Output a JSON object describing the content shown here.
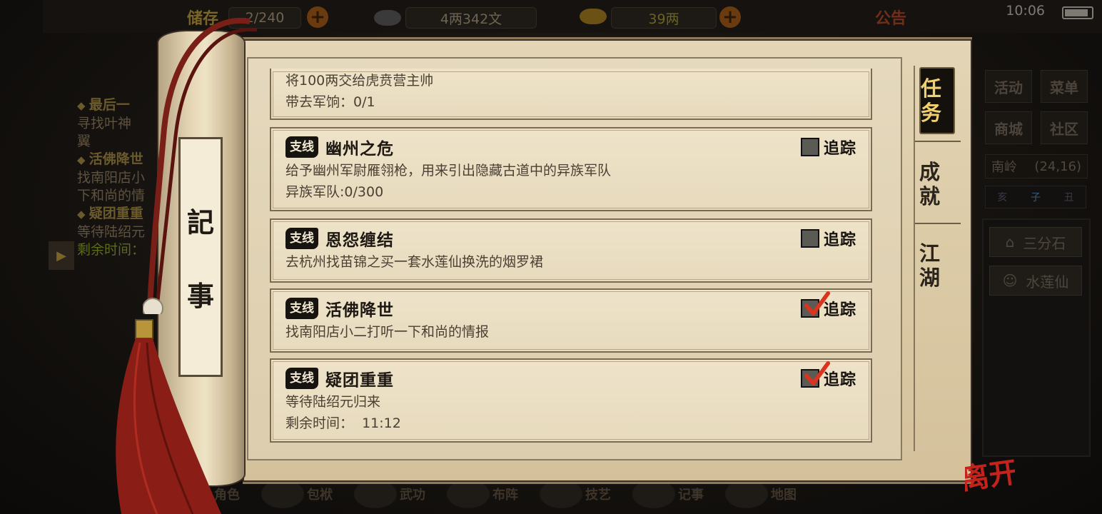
{
  "hud": {
    "bag_label": "储存",
    "bag_count": "2/240",
    "copper": "4两342文",
    "silver": "39两",
    "notice": "公告",
    "clock": "10:06"
  },
  "left_panel": {
    "quests": [
      {
        "title": "最后一",
        "desc": "寻找叶神\n翼"
      },
      {
        "title": "活佛降世",
        "desc": "找南阳店小\n下和尚的情"
      },
      {
        "title": "疑团重重",
        "desc": "等待陆绍元",
        "time": "剩余时间："
      }
    ]
  },
  "right_panel": {
    "buttons": [
      "活动",
      "菜单",
      "商城",
      "社区"
    ],
    "location_name": "南岭",
    "location_coords": "(24,16)",
    "time_marks": [
      "亥",
      "子",
      "丑"
    ],
    "npcs": [
      "三分石",
      "水莲仙"
    ]
  },
  "bottom_bar": [
    "角色",
    "包袱",
    "武功",
    "布阵",
    "技艺",
    "记事",
    "地图"
  ],
  "notebook": {
    "title_chars": [
      "記",
      "事"
    ],
    "tabs": {
      "task": "任务",
      "achievement": "成就",
      "jianghu": "江湖"
    },
    "leave_label": "离开"
  },
  "quests": [
    {
      "tag": "",
      "title": "",
      "desc": "将100两交给虎贲营主帅",
      "progress": "带去军饷：0/1",
      "tracked": null,
      "track_label": ""
    },
    {
      "tag": "支线",
      "title": "幽州之危",
      "desc": "给予幽州军尉雁翎枪，用来引出隐藏古道中的异族军队",
      "progress": "异族军队:0/300",
      "tracked": false,
      "track_label": "追踪"
    },
    {
      "tag": "支线",
      "title": "恩怨缠结",
      "desc": "去杭州找苗锦之买一套水莲仙换洗的烟罗裙",
      "progress": "",
      "tracked": false,
      "track_label": "追踪"
    },
    {
      "tag": "支线",
      "title": "活佛降世",
      "desc": "找南阳店小二打听一下和尚的情报",
      "progress": "",
      "tracked": true,
      "track_label": "追踪"
    },
    {
      "tag": "支线",
      "title": "疑团重重",
      "desc": "等待陆绍元归来",
      "progress": "剩余时间：  11:12",
      "tracked": true,
      "track_label": "追踪"
    }
  ],
  "colors": {
    "active_tab_text": "#f0cf6e",
    "tick": "#d9341e",
    "leave": "#c4231b"
  }
}
